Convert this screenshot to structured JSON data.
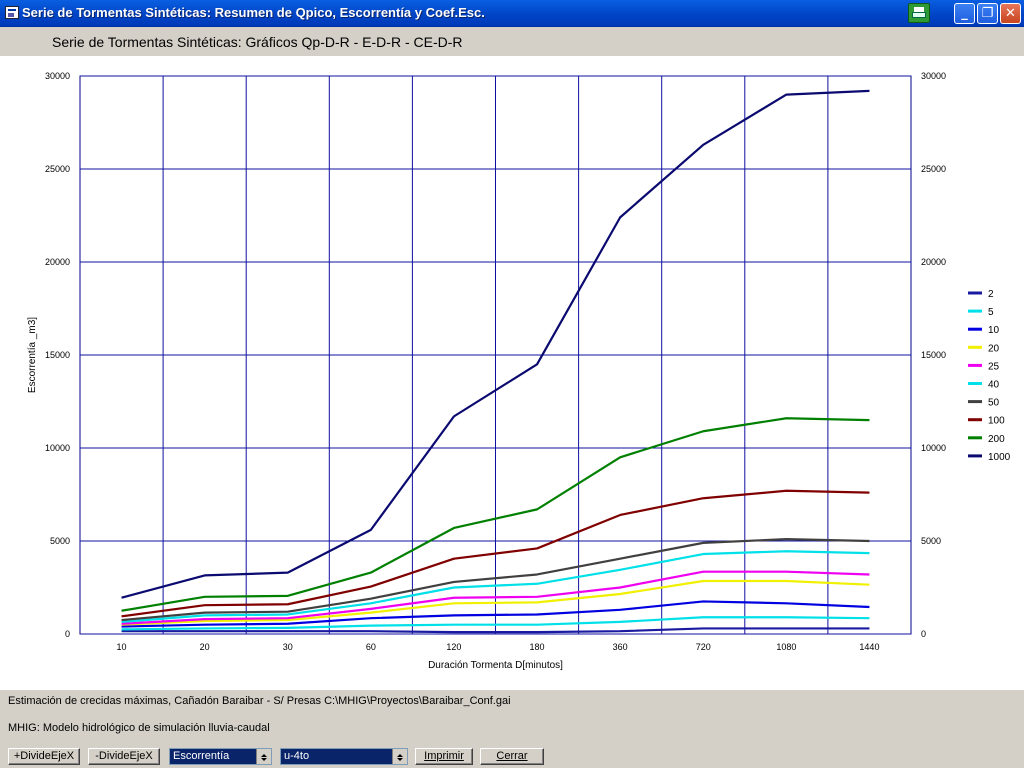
{
  "window": {
    "title": "Serie de Tormentas Sintéticas: Resumen de Qpico, Escorrentía y Coef.Esc."
  },
  "header": {
    "title": "Serie de Tormentas Sintéticas: Gráficos Qp-D-R  -  E-D-R  -  CE-D-R"
  },
  "icons": {
    "app": "app-window-icon",
    "print": "printer-icon",
    "minimize": "minimize-icon",
    "maximize": "restore-icon",
    "close": "close-icon"
  },
  "window_buttons": {
    "minimize": "_",
    "maximize": "❐",
    "close": "✕"
  },
  "chart_data": {
    "type": "line",
    "title": "",
    "xlabel": "Duración Tormenta D[minutos]",
    "ylabel": "Escorrentía _m3]",
    "categories": [
      "10",
      "20",
      "30",
      "60",
      "120",
      "180",
      "360",
      "720",
      "1080",
      "1440"
    ],
    "ylim": [
      0,
      30000
    ],
    "yticks": [
      0,
      5000,
      10000,
      15000,
      20000,
      25000,
      30000
    ],
    "grid": true,
    "legend_position": "right",
    "series": [
      {
        "name": "2",
        "color": "#1a1aa0",
        "values": [
          150,
          150,
          150,
          150,
          100,
          100,
          150,
          300,
          300,
          300
        ]
      },
      {
        "name": "5",
        "color": "#00e0e8",
        "values": [
          250,
          300,
          330,
          450,
          500,
          500,
          650,
          900,
          900,
          850
        ]
      },
      {
        "name": "10",
        "color": "#0000e0",
        "values": [
          400,
          500,
          550,
          850,
          1000,
          1050,
          1300,
          1750,
          1650,
          1450
        ]
      },
      {
        "name": "20",
        "color": "#f0f000",
        "values": [
          500,
          700,
          750,
          1150,
          1650,
          1700,
          2150,
          2850,
          2850,
          2650
        ]
      },
      {
        "name": "25",
        "color": "#f000f0",
        "values": [
          550,
          800,
          850,
          1350,
          1950,
          2000,
          2500,
          3350,
          3350,
          3200
        ]
      },
      {
        "name": "40",
        "color": "#00e0e8",
        "values": [
          650,
          1000,
          1050,
          1650,
          2500,
          2700,
          3450,
          4300,
          4450,
          4350
        ]
      },
      {
        "name": "50",
        "color": "#404040",
        "values": [
          750,
          1150,
          1200,
          1900,
          2800,
          3200,
          4050,
          4900,
          5100,
          5000
        ]
      },
      {
        "name": "100",
        "color": "#800000",
        "values": [
          950,
          1550,
          1600,
          2550,
          4050,
          4600,
          6400,
          7300,
          7700,
          7600
        ]
      },
      {
        "name": "200",
        "color": "#008000",
        "values": [
          1250,
          2000,
          2050,
          3300,
          5700,
          6700,
          9500,
          10900,
          11600,
          11500
        ]
      },
      {
        "name": "1000",
        "color": "#0a0a70",
        "values": [
          1950,
          3150,
          3300,
          5600,
          11700,
          14500,
          22400,
          26300,
          29000,
          29200
        ]
      }
    ]
  },
  "status": {
    "line1": "Estimación de crecidas máximas, Cañadón Baraibar - S/ Presas  C:\\MHIG\\Proyectos\\Baraibar_Conf.gai",
    "line2": "MHIG: Modelo hidrológico de simulación lluvia-caudal"
  },
  "controls": {
    "inc_axis": "+DivideEjeX",
    "dec_axis": "-DivideEjeX",
    "variable_select": "Escorrentía",
    "mode_select": "u-4to",
    "print": "Imprimir",
    "close": "Cerrar"
  }
}
